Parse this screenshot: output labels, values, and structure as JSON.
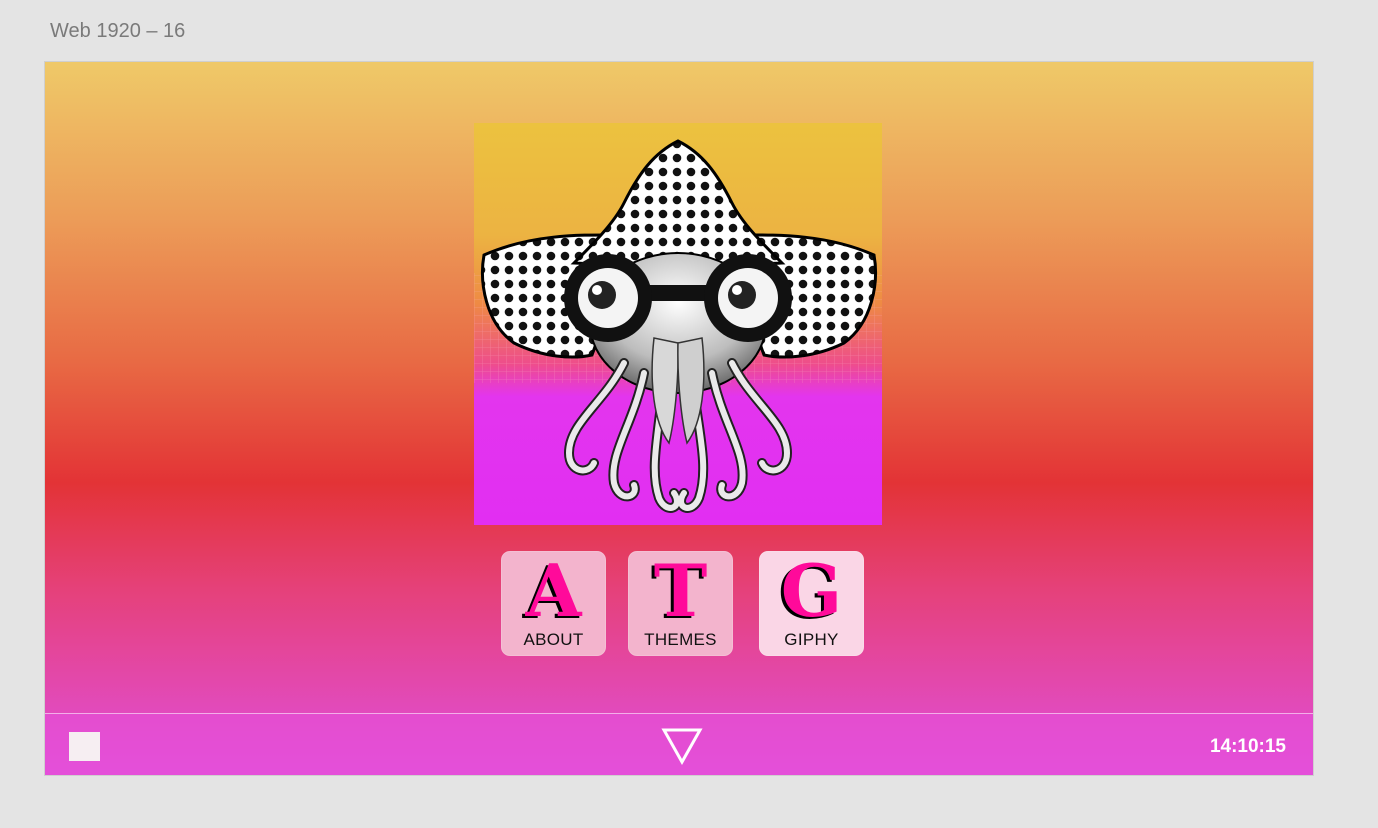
{
  "artboard": {
    "label": "Web 1920 – 16"
  },
  "hero": {
    "image": "squid-with-polka-dot-hat-and-goggles-illustration",
    "colors": {
      "top": "#efc23e",
      "bottom": "#e42cf2"
    }
  },
  "tiles": [
    {
      "letter": "A",
      "label": "ABOUT"
    },
    {
      "letter": "T",
      "label": "THEMES"
    },
    {
      "letter": "G",
      "label": "GIPHY"
    }
  ],
  "taskbar": {
    "start_icon": "square-icon",
    "launcher_icon": "triangle-down-icon",
    "clock": "14:10:15"
  },
  "colors": {
    "accent": "#ff0a9a",
    "tile_bg": "#f3b4cd"
  }
}
